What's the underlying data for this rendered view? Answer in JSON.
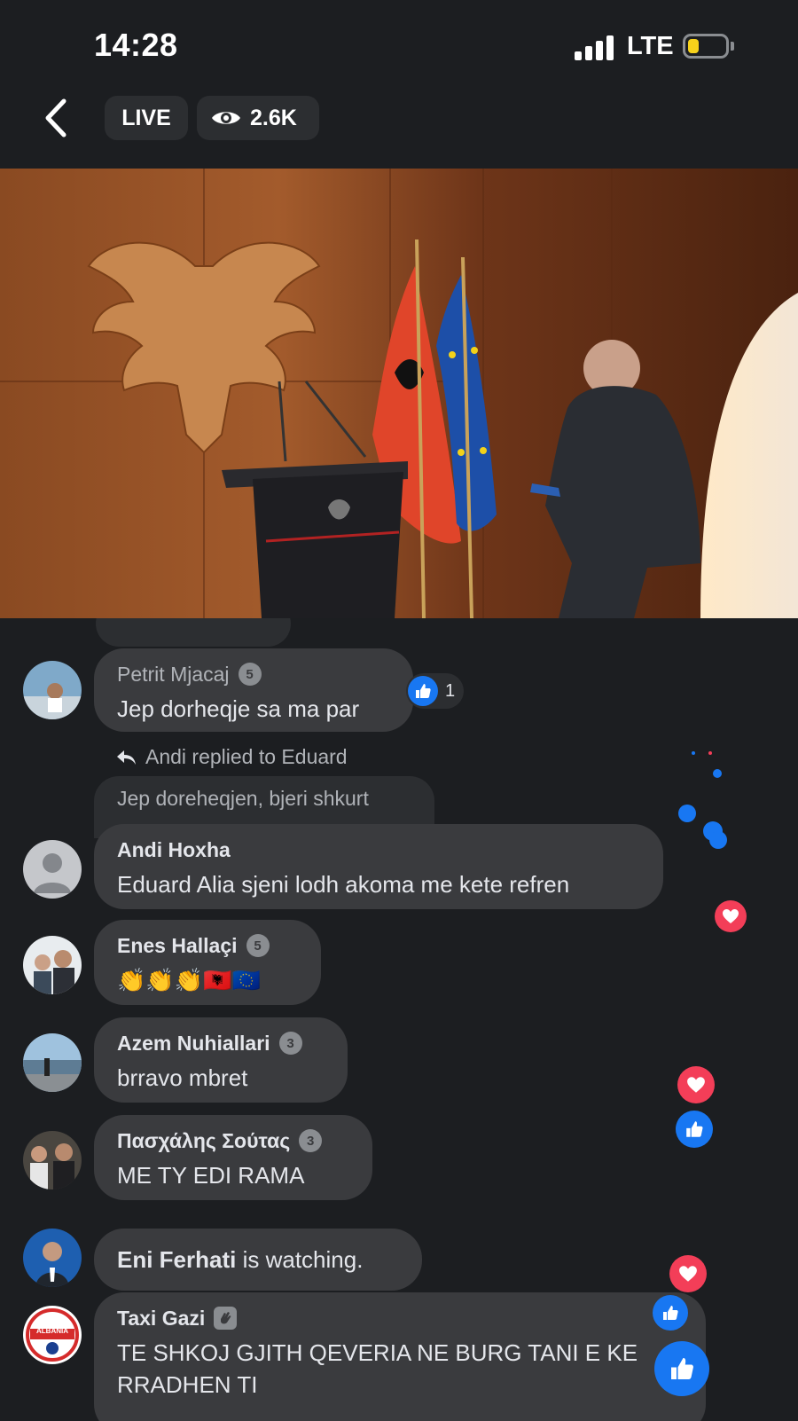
{
  "status_bar": {
    "time": "14:28",
    "network": "LTE",
    "battery_color": "#f7d21b"
  },
  "header": {
    "live_label": "LIVE",
    "viewer_count": "2.6K"
  },
  "colors": {
    "like": "#1877f2",
    "love": "#f33e58",
    "bubble": "#3a3b3e",
    "background": "#1c1e21"
  },
  "comments": [
    {
      "name": "Petrit Mjacaj",
      "badge": "5",
      "text": "Jep dorheqje sa ma par",
      "likes": "1"
    },
    {
      "reply_context": "Andi replied to Eduard",
      "quoted": "Jep doreheqjen, bjeri shkurt"
    },
    {
      "name": "Andi Hoxha",
      "text": "Eduard Alia sjeni lodh akoma me kete refren"
    },
    {
      "name": "Enes Hallaçi",
      "badge": "5",
      "text": "👏👏👏🇦🇱🇪🇺"
    },
    {
      "name": "Azem Nuhiallari",
      "badge": "3",
      "text": "brravo mbret"
    },
    {
      "name": "Πασχάλης Σούτας",
      "badge": "3",
      "text": "ME TY EDI RAMA"
    },
    {
      "name": "Eni Ferhati",
      "text": "is watching."
    },
    {
      "name": "Taxi Gazi",
      "text": "TE SHKOJ GJITH QEVERIA NE BURG TANI E KE RRADHEN TI",
      "avatar_text": "ALBANIA"
    }
  ]
}
